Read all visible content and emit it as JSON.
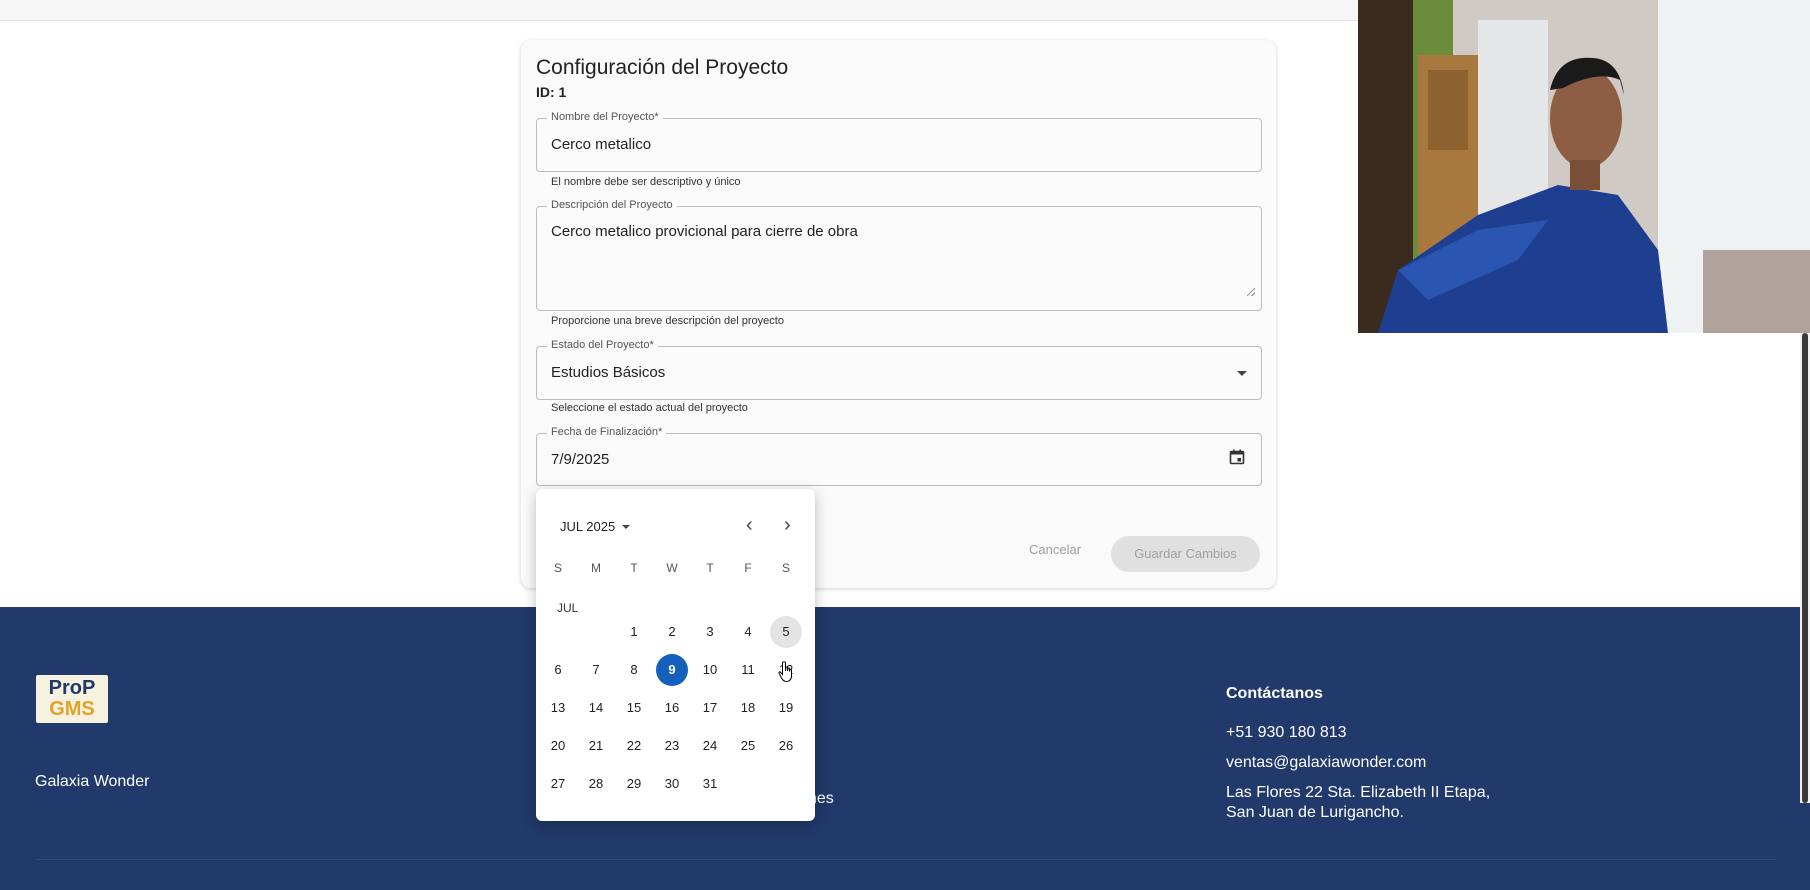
{
  "form": {
    "title": "Configuración del Proyecto",
    "id_text": "ID: 1",
    "name_field": {
      "label": "Nombre del Proyecto*",
      "value": "Cerco metalico",
      "helper": "El nombre debe ser descriptivo y único"
    },
    "description_field": {
      "label": "Descripción del Proyecto",
      "value": "Cerco metalico provicional para cierre de obra",
      "helper": "Proporcione una breve descripción del proyecto"
    },
    "status_field": {
      "label": "Estado del Proyecto*",
      "value": "Estudios Básicos",
      "helper": "Seleccione el estado actual del proyecto"
    },
    "date_field": {
      "label": "Fecha de Finalización*",
      "value": "7/9/2025"
    },
    "cancel_label": "Cancelar",
    "save_label": "Guardar Cambios"
  },
  "datepicker": {
    "month_year": "JUL 2025",
    "prev_icon": "‹",
    "next_icon": "›",
    "weekdays": [
      "S",
      "M",
      "T",
      "W",
      "T",
      "F",
      "S"
    ],
    "month_label": "JUL",
    "selected_day": 9,
    "hovered_day": 5,
    "first_weekday_index": 2,
    "days_in_month": 31
  },
  "footer": {
    "logo_line1": "ProP",
    "logo_line2": "GMS",
    "brand": "Galaxia Wonder",
    "partial_text": "nes",
    "contact_title": "Contáctanos",
    "phone": "+51 930 180 813",
    "email": "ventas@galaxiawonder.com",
    "address_line1": "Las Flores 22 Sta. Elizabeth II Etapa,",
    "address_line2": "San Juan de Lurigancho."
  },
  "colors": {
    "footer_bg": "#21396b",
    "selected_day": "#1560bd",
    "logo_accent": "#e2a22a"
  },
  "icons": {
    "status_dropdown": "caret-down-icon",
    "date_field": "calendar-icon",
    "month_dropdown": "caret-down-icon"
  }
}
